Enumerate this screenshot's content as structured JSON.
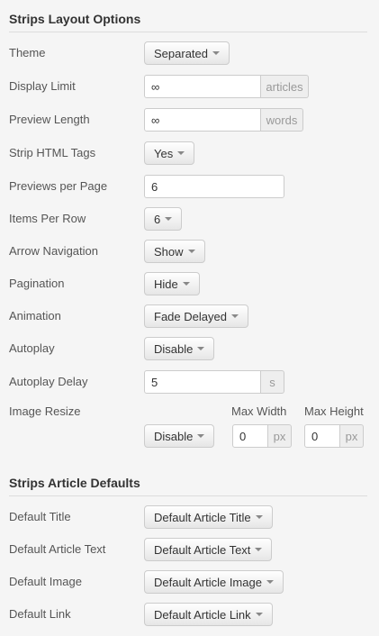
{
  "layout_section": {
    "title": "Strips Layout Options",
    "rows": {
      "theme": {
        "label": "Theme",
        "value": "Separated"
      },
      "display_limit": {
        "label": "Display Limit",
        "value": "∞",
        "unit": "articles"
      },
      "preview_length": {
        "label": "Preview Length",
        "value": "∞",
        "unit": "words"
      },
      "strip_html": {
        "label": "Strip HTML Tags",
        "value": "Yes"
      },
      "previews_per_page": {
        "label": "Previews per Page",
        "value": "6"
      },
      "items_per_row": {
        "label": "Items Per Row",
        "value": "6"
      },
      "arrow_navigation": {
        "label": "Arrow Navigation",
        "value": "Show"
      },
      "pagination": {
        "label": "Pagination",
        "value": "Hide"
      },
      "animation": {
        "label": "Animation",
        "value": "Fade Delayed"
      },
      "autoplay": {
        "label": "Autoplay",
        "value": "Disable"
      },
      "autoplay_delay": {
        "label": "Autoplay Delay",
        "value": "5",
        "unit": "s"
      },
      "image_resize": {
        "label": "Image Resize",
        "value": "Disable",
        "max_width_label": "Max Width",
        "max_width_value": "0",
        "max_height_label": "Max Height",
        "max_height_value": "0",
        "unit": "px"
      }
    }
  },
  "defaults_section": {
    "title": "Strips Article Defaults",
    "rows": {
      "default_title": {
        "label": "Default Title",
        "value": "Default Article Title"
      },
      "default_text": {
        "label": "Default Article Text",
        "value": "Default Article Text"
      },
      "default_image": {
        "label": "Default Image",
        "value": "Default Article Image"
      },
      "default_link": {
        "label": "Default Link",
        "value": "Default Article Link"
      }
    }
  }
}
